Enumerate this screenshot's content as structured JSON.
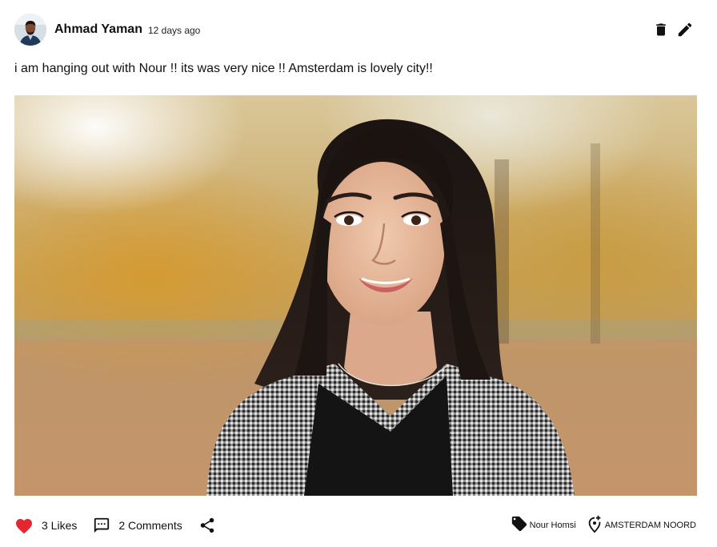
{
  "post": {
    "author_name": "Ahmad Yaman",
    "timestamp": "12 days ago",
    "text": "i am hanging out with Nour !! its was very nice !! Amsterdam is lovely city!!",
    "avatar_icon": "user-avatar",
    "photo_icon": "portrait-photo"
  },
  "header_actions": {
    "delete_icon": "trash-icon",
    "edit_icon": "pencil-icon"
  },
  "footer": {
    "likes_label": "3 Likes",
    "comments_label": "2 Comments",
    "share_icon": "share-icon",
    "tagged_person": "Nour Homsi",
    "location": "AMSTERDAM NOORD"
  },
  "colors": {
    "like_red": "#e3262f",
    "text_dark": "#111111",
    "background": "#ffffff"
  }
}
